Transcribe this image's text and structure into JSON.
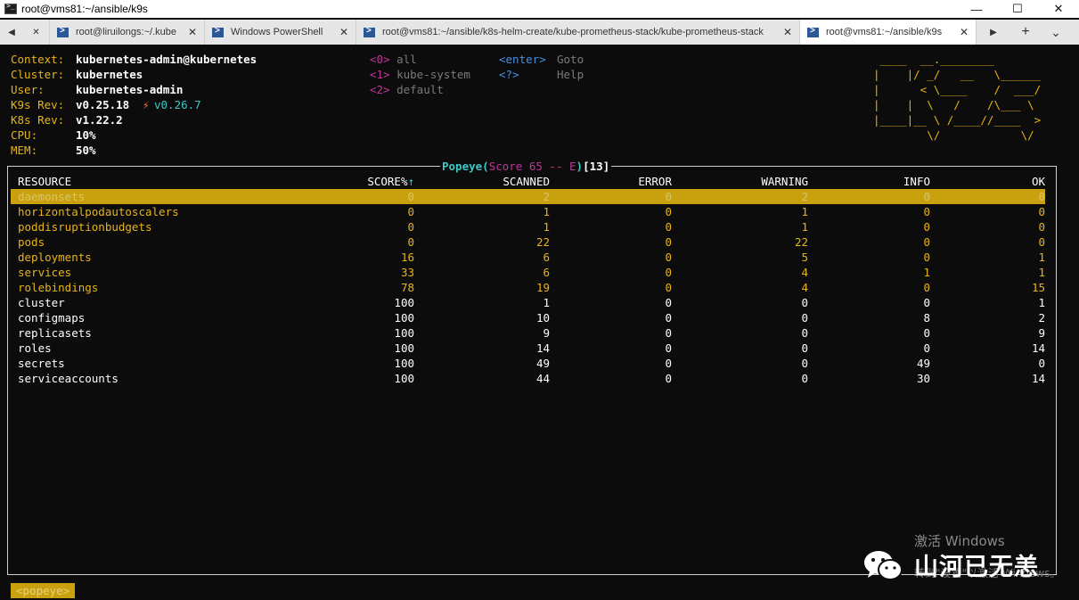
{
  "window": {
    "title": "root@vms81:~/ansible/k9s",
    "minimize": "—",
    "maximize": "☐",
    "close": "✕"
  },
  "tabs": {
    "back": "◀",
    "close_first": "✕",
    "forward": "▶",
    "new_tab": "+",
    "dropdown": "⌄",
    "items": [
      {
        "label": "root@liruilongs:~/.kube",
        "icon": "powershell-icon",
        "close": "✕"
      },
      {
        "label": "Windows PowerShell",
        "icon": "powershell-icon",
        "close": "✕"
      },
      {
        "label": "root@vms81:~/ansible/k8s-helm-create/kube-prometheus-stack/kube-prometheus-stack",
        "icon": "powershell-icon",
        "close": "✕"
      },
      {
        "label": "root@vms81:~/ansible/k9s",
        "icon": "powershell-icon",
        "close": "✕"
      }
    ]
  },
  "info": {
    "context_label": "Context:",
    "context": "kubernetes-admin@kubernetes",
    "cluster_label": "Cluster:",
    "cluster": "kubernetes",
    "user_label": "User:",
    "user": "kubernetes-admin",
    "k9s_rev_label": "K9s Rev:",
    "k9s_rev": "v0.25.18",
    "k9s_update_icon": "⚡",
    "k9s_update": "v0.26.7",
    "k8s_rev_label": "K8s Rev:",
    "k8s_rev": "v1.22.2",
    "cpu_label": "CPU:",
    "cpu": "10%",
    "mem_label": "MEM:",
    "mem": "50%"
  },
  "menu": {
    "ns": [
      {
        "key": "<0>",
        "label": "all"
      },
      {
        "key": "<1>",
        "label": "kube-system"
      },
      {
        "key": "<2>",
        "label": "default"
      }
    ],
    "actions": [
      {
        "key": "<enter>",
        "label": "Goto"
      },
      {
        "key": "<?>",
        "label": "Help"
      }
    ]
  },
  "logo": {
    "lines": [
      " ____  __.________       ",
      "|    |/ _/   __   \\______",
      "|      < \\____    /  ___/",
      "|    |  \\   /    /\\___ \\ ",
      "|____|__ \\ /____//____  >",
      "        \\/            \\/ "
    ]
  },
  "table": {
    "title_name": "Popeye",
    "title_paren_open": "(",
    "title_score": "Score 65 -- E",
    "title_paren_close": ")",
    "title_count": "[13]",
    "headers": {
      "resource": "RESOURCE",
      "score": "SCORE%",
      "score_sort": "↑",
      "scanned": "SCANNED",
      "error": "ERROR",
      "warning": "WARNING",
      "info": "INFO",
      "ok": "OK"
    },
    "rows": [
      {
        "resource": "daemonsets",
        "score": "0",
        "scanned": "2",
        "error": "0",
        "warning": "2",
        "info": "0",
        "ok": "0"
      },
      {
        "resource": "horizontalpodautoscalers",
        "score": "0",
        "scanned": "1",
        "error": "0",
        "warning": "1",
        "info": "0",
        "ok": "0"
      },
      {
        "resource": "poddisruptionbudgets",
        "score": "0",
        "scanned": "1",
        "error": "0",
        "warning": "1",
        "info": "0",
        "ok": "0"
      },
      {
        "resource": "pods",
        "score": "0",
        "scanned": "22",
        "error": "0",
        "warning": "22",
        "info": "0",
        "ok": "0"
      },
      {
        "resource": "deployments",
        "score": "16",
        "scanned": "6",
        "error": "0",
        "warning": "5",
        "info": "0",
        "ok": "1"
      },
      {
        "resource": "services",
        "score": "33",
        "scanned": "6",
        "error": "0",
        "warning": "4",
        "info": "1",
        "ok": "1"
      },
      {
        "resource": "rolebindings",
        "score": "78",
        "scanned": "19",
        "error": "0",
        "warning": "4",
        "info": "0",
        "ok": "15"
      },
      {
        "resource": "cluster",
        "score": "100",
        "scanned": "1",
        "error": "0",
        "warning": "0",
        "info": "0",
        "ok": "1"
      },
      {
        "resource": "configmaps",
        "score": "100",
        "scanned": "10",
        "error": "0",
        "warning": "0",
        "info": "8",
        "ok": "2"
      },
      {
        "resource": "replicasets",
        "score": "100",
        "scanned": "9",
        "error": "0",
        "warning": "0",
        "info": "0",
        "ok": "9"
      },
      {
        "resource": "roles",
        "score": "100",
        "scanned": "14",
        "error": "0",
        "warning": "0",
        "info": "0",
        "ok": "14"
      },
      {
        "resource": "secrets",
        "score": "100",
        "scanned": "49",
        "error": "0",
        "warning": "0",
        "info": "49",
        "ok": "0"
      },
      {
        "resource": "serviceaccounts",
        "score": "100",
        "scanned": "44",
        "error": "0",
        "warning": "0",
        "info": "30",
        "ok": "14"
      }
    ]
  },
  "crumb": "<popeye>",
  "watermark": {
    "brand": "山河已无恙",
    "activate_title": "激活 Windows",
    "activate_sub": "转到\"设置\"以激活 Windows。"
  },
  "colors": {
    "terminal_bg": "#0c0c0c",
    "label_yellow": "#e8b417",
    "hint_magenta": "#c0359a",
    "hint_blue": "#4a90e2",
    "cyan": "#3cc8c8",
    "selection": "#c9a10f"
  }
}
